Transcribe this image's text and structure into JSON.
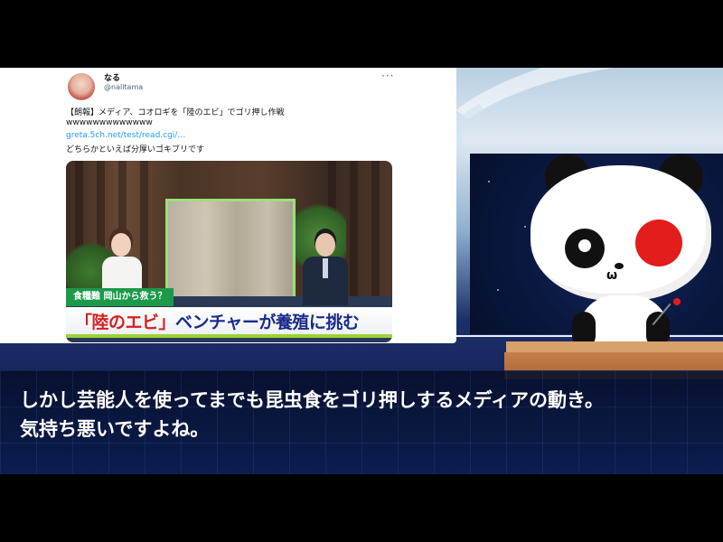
{
  "tweet": {
    "user_name": "なる",
    "user_handle": "@nalltama",
    "more_icon": "more-horizontal-icon",
    "text_line1": "【朗報】メディア、コオロギを「陸のエビ」でゴリ押し作戦",
    "text_line2": "wwwwwwwwwwwww",
    "link": "greta.5ch.net/test/read.cgi/…",
    "text_line3": "どちらかといえば分厚いゴキブリです"
  },
  "media": {
    "caption_tag": "食糧難 岡山から救う？",
    "caption_highlight": "「陸のエビ」",
    "caption_rest": "ベンチャーが養殖に挑む"
  },
  "subtitle": {
    "line1": "しかし芸能人を使ってまでも昆虫食をゴリ押しするメディアの動き。",
    "line2": "気持ち悪いですよね。"
  },
  "colors": {
    "caption_blue": "#1a2b8a",
    "caption_red": "#d61f1f",
    "caption_green": "#1c9a4a",
    "panda_red": "#e31c1c"
  }
}
